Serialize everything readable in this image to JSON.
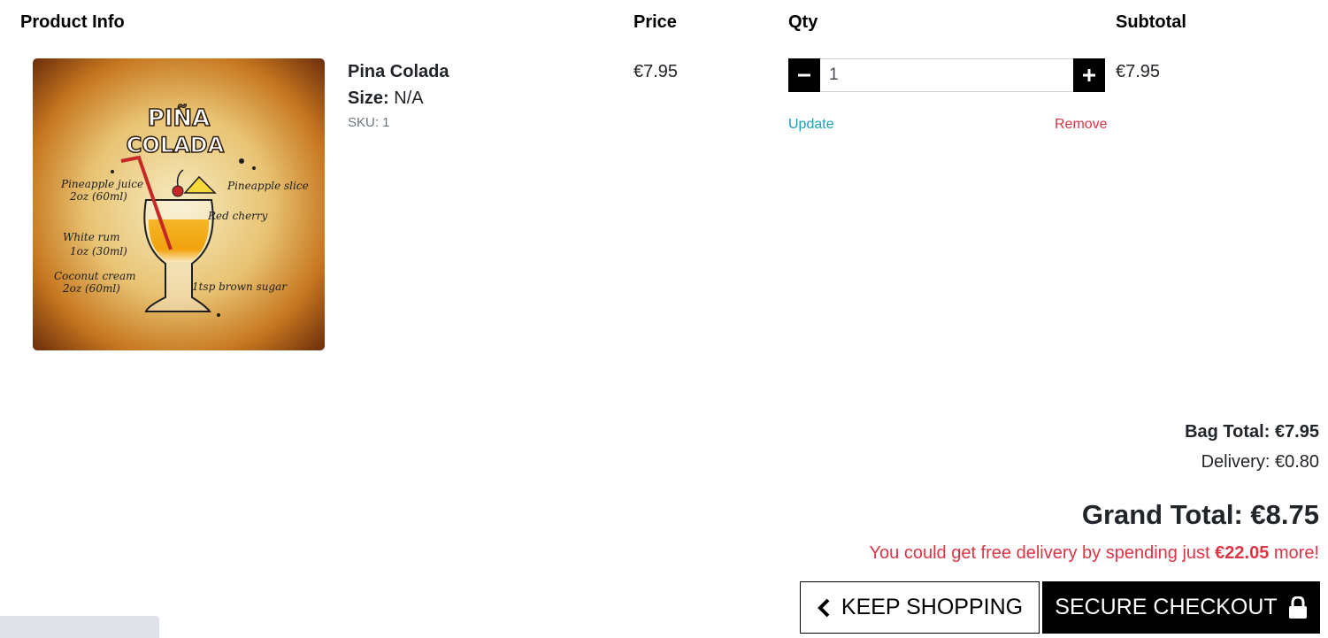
{
  "table": {
    "headers": {
      "product": "Product Info",
      "price": "Price",
      "qty": "Qty",
      "subtotal": "Subtotal"
    }
  },
  "item": {
    "name": "Pina Colada",
    "size_label": "Size:",
    "size_value": "N/A",
    "sku": "SKU: 1",
    "price": "€7.95",
    "subtotal": "€7.95",
    "quantity": "1",
    "update_label": "Update",
    "remove_label": "Remove",
    "image": {
      "title_line1": "PIÑA",
      "title_line2": "COLADA",
      "labels": [
        "Pineapple juice",
        "2oz (60ml)",
        "Pineapple slice",
        "Red cherry",
        "White rum",
        "1oz (30ml)",
        "Coconut cream",
        "2oz (60ml)",
        "1tsp brown sugar"
      ]
    }
  },
  "summary": {
    "bag_total": "Bag Total: €7.95",
    "delivery": "Delivery: €0.80",
    "grand_total": "Grand Total: €8.75",
    "free_delivery_prefix": "You could get free delivery by spending just ",
    "free_delivery_amount": "€22.05",
    "free_delivery_suffix": " more!"
  },
  "actions": {
    "keep_shopping": "KEEP SHOPPING",
    "secure_checkout": "SECURE CHECKOUT"
  },
  "icons": {
    "minus": "minus-icon",
    "plus": "plus-icon",
    "chevron": "chevron-left-icon",
    "lock": "lock-icon"
  },
  "colors": {
    "update_link": "#17a2b8",
    "remove_link": "#dc3545",
    "button_dark": "#000000"
  }
}
